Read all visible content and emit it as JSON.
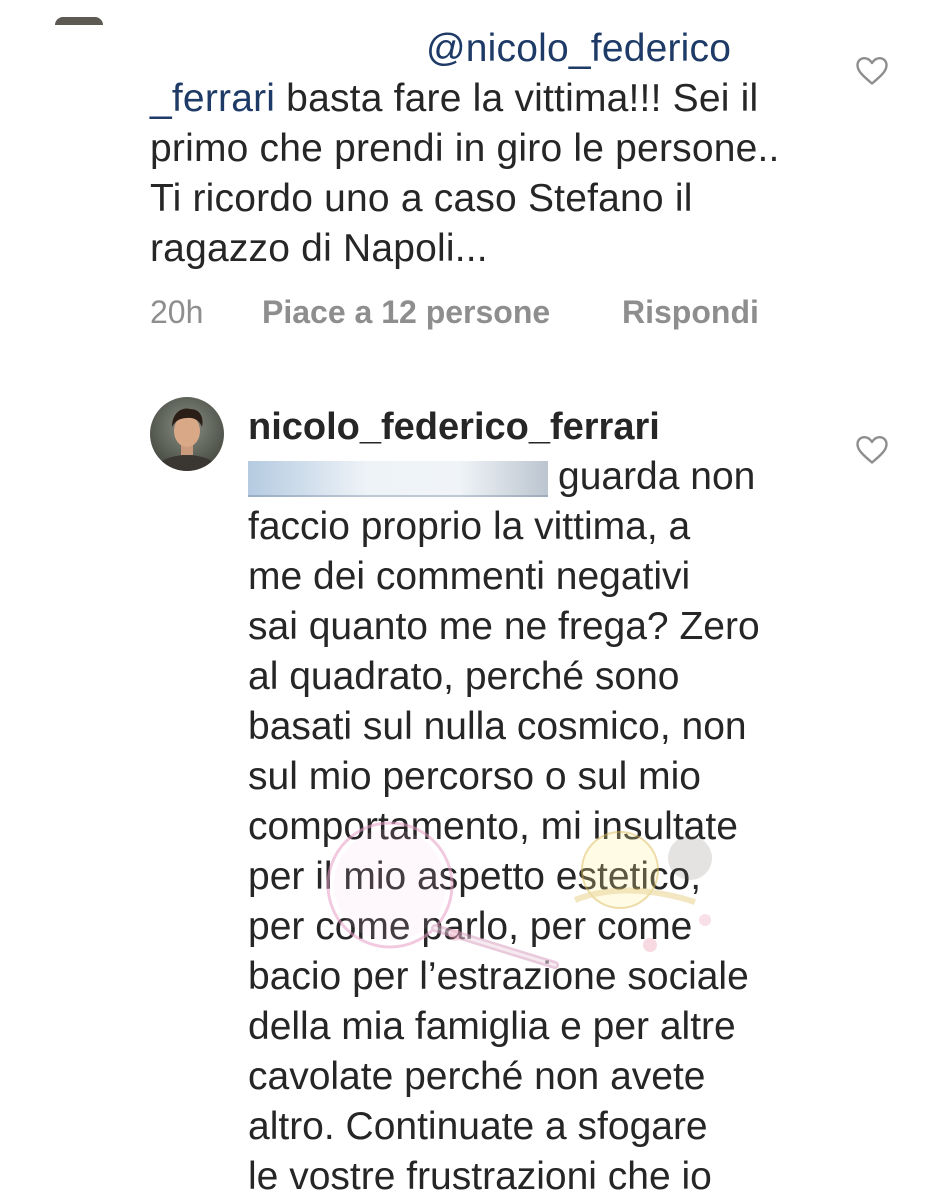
{
  "reply": {
    "mention": "@nicolo_federico",
    "mention_cont": "_ferrari",
    "line2_rest": " basta fare la vittima!!! Sei il",
    "line3": "primo che prendi in giro le persone..",
    "line4": "Ti ricordo uno a caso Stefano il",
    "line5": "ragazzo di Napoli...",
    "time": "20h",
    "likes": "Piace a 12 persone",
    "reply_label": "Rispondi"
  },
  "comment": {
    "username": "nicolo_federico_ferrari",
    "lines": [
      "guarda non",
      "faccio proprio la vittima, a",
      "me dei commenti negativi",
      "sai quanto me ne frega? Zero",
      "al quadrato, perché sono",
      "basati sul nulla cosmico, non",
      "sul mio percorso o sul mio",
      "comportamento, mi insultate",
      "per il mio aspetto estetico,",
      "per come parlo, per come",
      "bacio per l’estrazione sociale",
      "della mia famiglia e per altre",
      "cavolate perché non avete",
      "altro. Continuate a sfogare",
      "le vostre frustrazioni che io"
    ]
  },
  "icons": {
    "like": "heart-outline-icon",
    "avatar": "profile-photo"
  },
  "colors": {
    "text": "#262626",
    "meta": "#8e8e8e",
    "mention": "#1e3a66",
    "heart": "#8e8e8e"
  }
}
